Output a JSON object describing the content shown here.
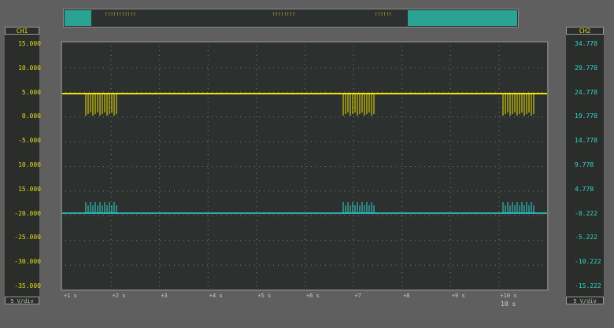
{
  "top_bar": {
    "segments": [
      "!!!!!!!!!!!",
      "!!!!!!!!",
      "!!!!!!"
    ]
  },
  "ch1": {
    "label": "CH1",
    "color": "#f2e400",
    "ticks": [
      "15.000",
      "10.000",
      "5.000",
      "0.000",
      "-5.000",
      "10.000",
      "15.000",
      "-20.000",
      "-25.000",
      "-30.000",
      "-35.000"
    ],
    "scale": "5 V/div"
  },
  "ch2": {
    "label": "CH2",
    "color": "#2fd7d0",
    "ticks": [
      "34.778",
      "29.778",
      "24.778",
      "19.778",
      "14.778",
      "9.778",
      "4.778",
      "-0.222",
      "-5.222",
      "-10.222",
      "-15.222"
    ],
    "scale": "5 V/div"
  },
  "x_ticks": [
    "+1 s",
    "+2 s",
    "+3",
    "+4 s",
    "+5 s",
    "+6 s",
    "+7",
    "+8",
    "+9 s",
    "+10 s"
  ],
  "timebase": "10 s",
  "chart_data": {
    "type": "line",
    "series": [
      {
        "name": "CH1",
        "baseline": 5.0,
        "burst_low": 0.0
      },
      {
        "name": "CH2",
        "baseline": -0.222,
        "burst_high": 1.7
      }
    ],
    "burst_x": [
      0.13,
      0.67,
      1.0
    ]
  }
}
